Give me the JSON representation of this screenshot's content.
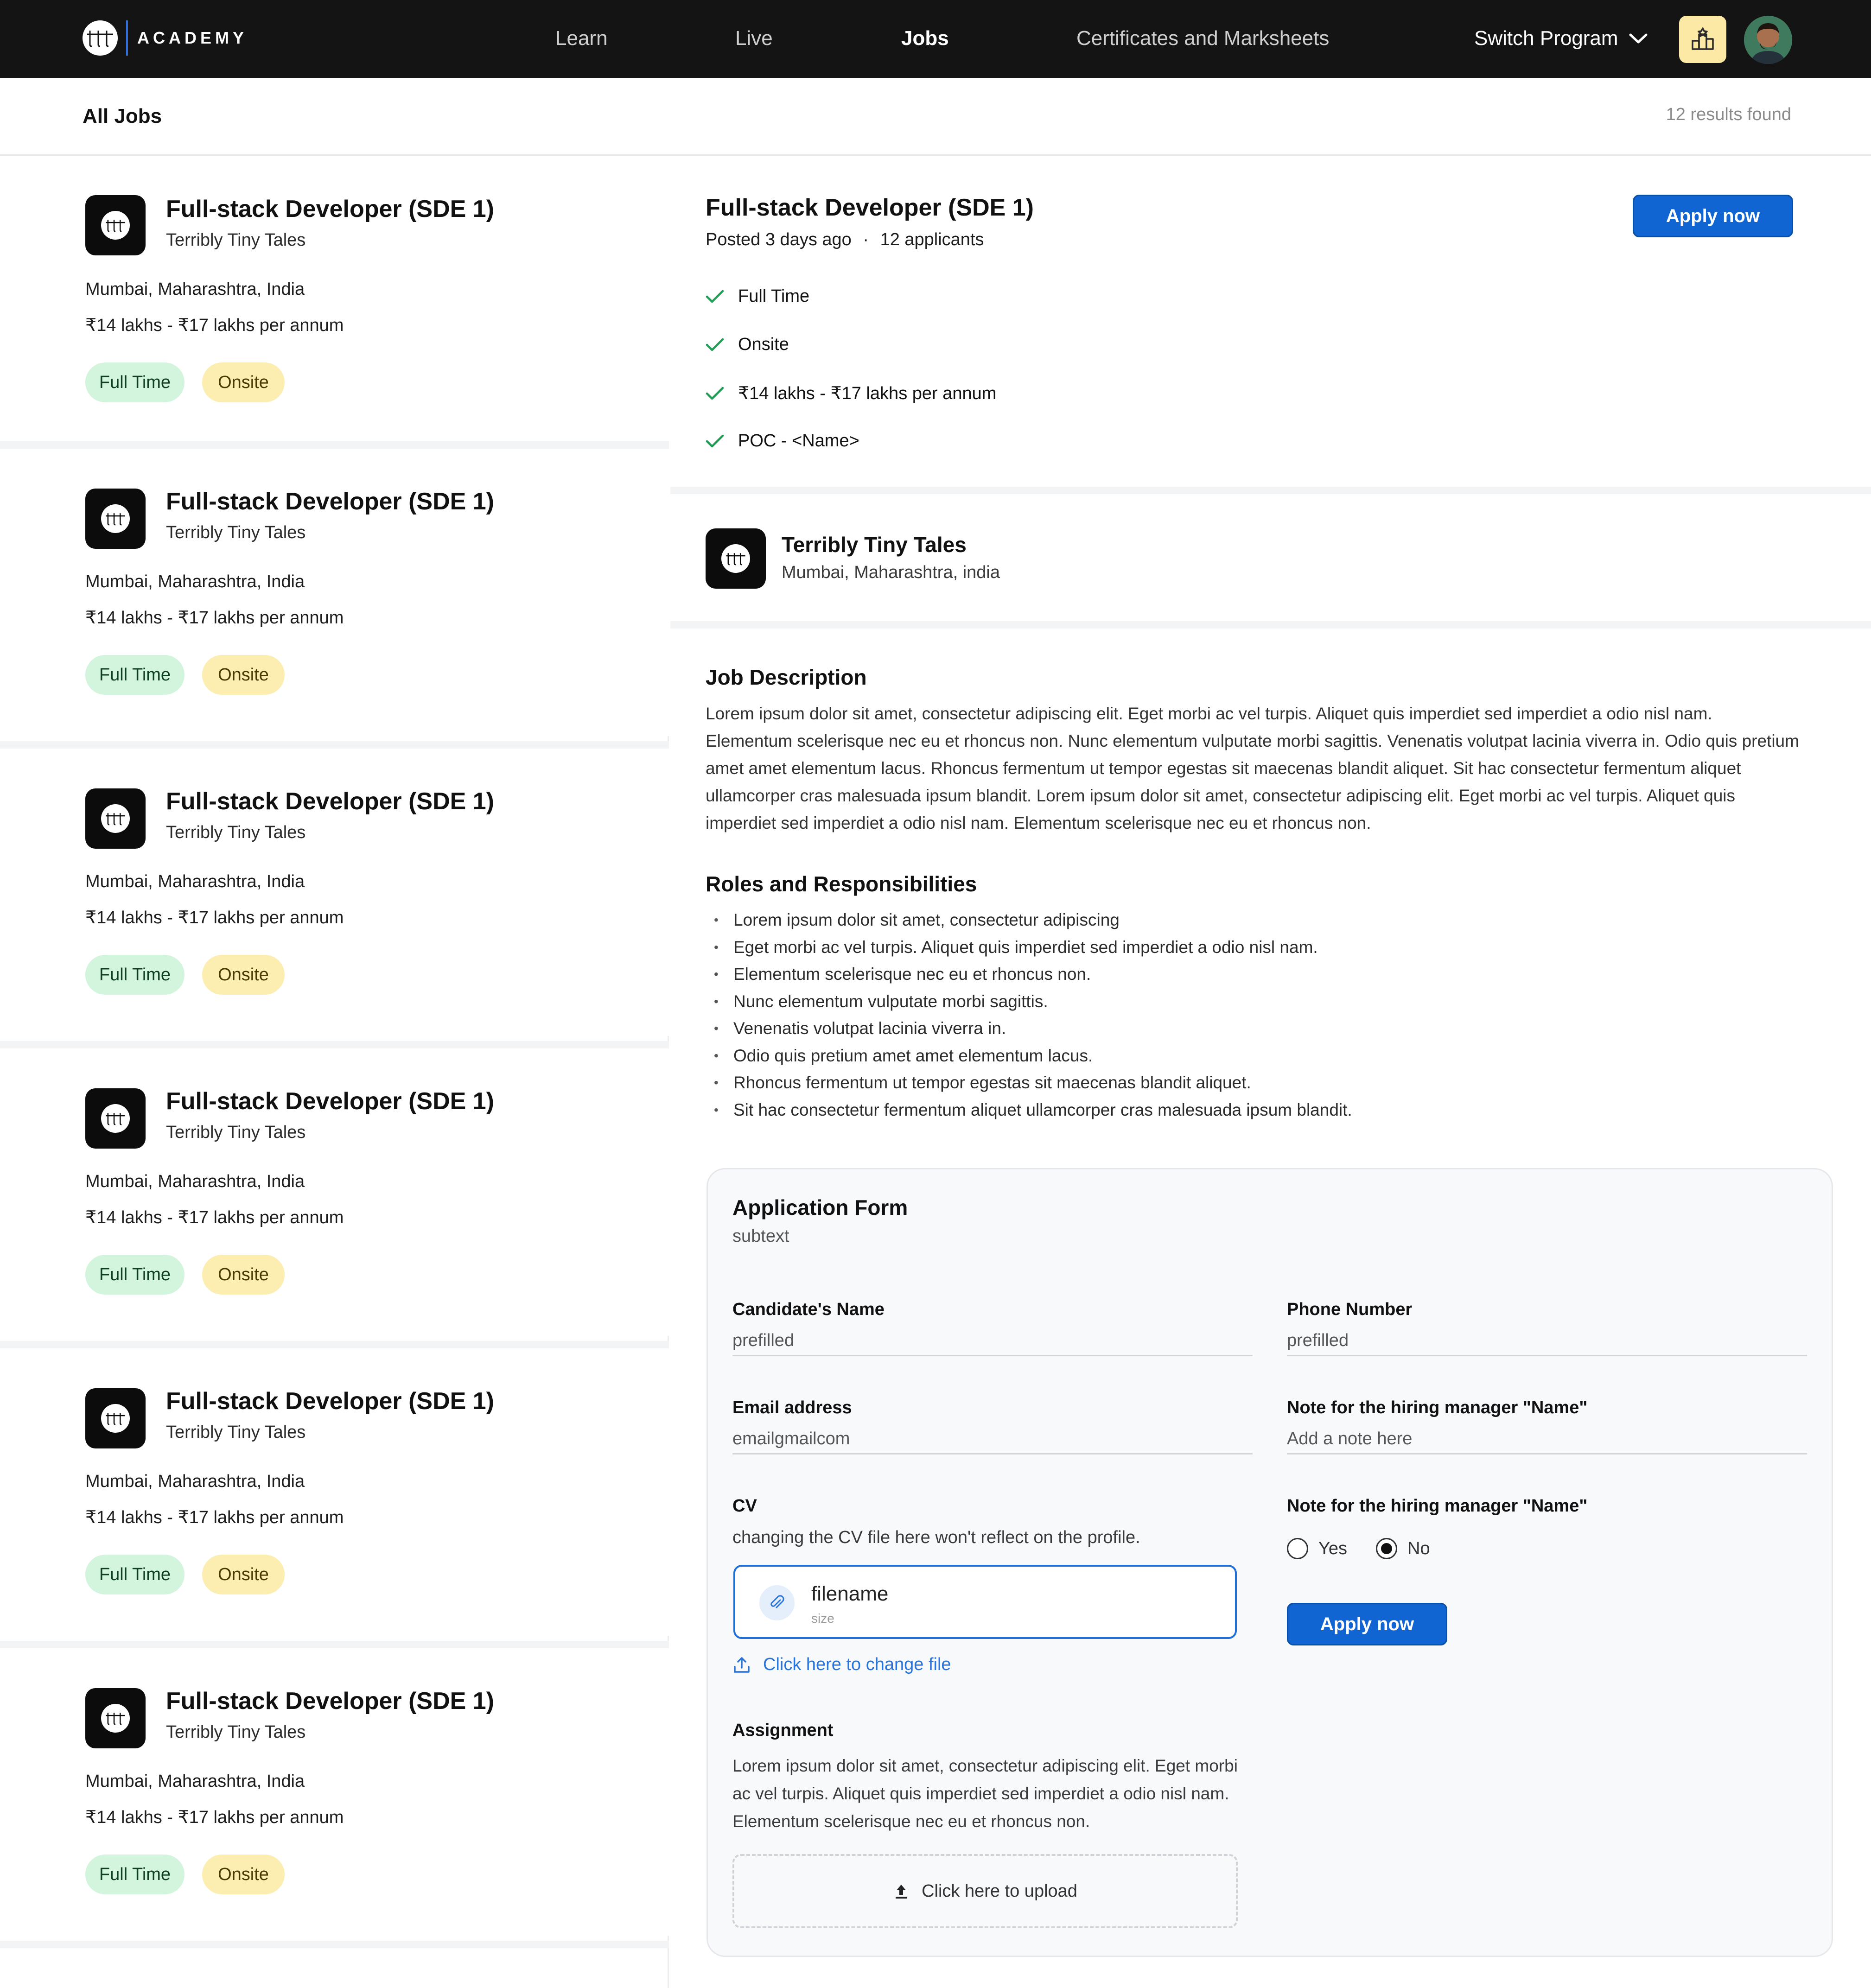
{
  "nav": {
    "brand": "ACADEMY",
    "links": [
      "Learn",
      "Live",
      "Jobs",
      "Certificates and Marksheets"
    ],
    "active": "Jobs",
    "switch_program": "Switch Program",
    "icons": {
      "leaderboard": "leaderboard-icon",
      "chevron": "chevron-down-icon",
      "avatar": "user-avatar"
    },
    "colors": {
      "bar": "#141414",
      "leader_button": "#fde9a6"
    }
  },
  "subheader": {
    "title": "All Jobs",
    "results": "12 results found"
  },
  "jobs": [
    {
      "title": "Full-stack Developer (SDE 1)",
      "company": "Terribly Tiny Tales",
      "location": "Mumbai, Maharashtra, India",
      "salary": "₹14 lakhs - ₹17 lakhs per annum",
      "tags": [
        "Full Time",
        "Onsite"
      ]
    },
    {
      "title": "Full-stack Developer (SDE 1)",
      "company": "Terribly Tiny Tales",
      "location": "Mumbai, Maharashtra, India",
      "salary": "₹14 lakhs - ₹17 lakhs per annum",
      "tags": [
        "Full Time",
        "Onsite"
      ]
    },
    {
      "title": "Full-stack Developer (SDE 1)",
      "company": "Terribly Tiny Tales",
      "location": "Mumbai, Maharashtra, India",
      "salary": "₹14 lakhs - ₹17 lakhs per annum",
      "tags": [
        "Full Time",
        "Onsite"
      ]
    },
    {
      "title": "Full-stack Developer (SDE 1)",
      "company": "Terribly Tiny Tales",
      "location": "Mumbai, Maharashtra, India",
      "salary": "₹14 lakhs - ₹17 lakhs per annum",
      "tags": [
        "Full Time",
        "Onsite"
      ]
    },
    {
      "title": "Full-stack Developer (SDE 1)",
      "company": "Terribly Tiny Tales",
      "location": "Mumbai, Maharashtra, India",
      "salary": "₹14 lakhs - ₹17 lakhs per annum",
      "tags": [
        "Full Time",
        "Onsite"
      ]
    },
    {
      "title": "Full-stack Developer (SDE 1)",
      "company": "Terribly Tiny Tales",
      "location": "Mumbai, Maharashtra, India",
      "salary": "₹14 lakhs - ₹17 lakhs per annum",
      "tags": [
        "Full Time",
        "Onsite"
      ]
    }
  ],
  "detail": {
    "title": "Full-stack Developer (SDE 1)",
    "posted": "Posted 3 days ago",
    "applicants": "12 applicants",
    "meta_separator": "·",
    "apply_label": "Apply now",
    "highlights": [
      "Full Time",
      "Onsite",
      "₹14 lakhs - ₹17 lakhs per annum",
      "POC - <Name>"
    ],
    "company": {
      "name": "Terribly Tiny Tales",
      "location": "Mumbai, Maharashtra, india"
    },
    "description_heading": "Job Description",
    "description": "Lorem ipsum dolor sit amet, consectetur adipiscing elit. Eget morbi ac vel turpis. Aliquet quis imperdiet sed imperdiet a odio nisl nam. Elementum scelerisque nec eu et rhoncus non. Nunc elementum vulputate morbi sagittis. Venenatis volutpat lacinia viverra in. Odio quis pretium amet amet elementum lacus. Rhoncus fermentum ut tempor egestas sit maecenas blandit aliquet. Sit hac consectetur fermentum aliquet ullamcorper cras malesuada ipsum blandit. Lorem ipsum dolor sit amet, consectetur adipiscing elit. Eget morbi ac vel turpis. Aliquet quis imperdiet sed imperdiet a odio nisl nam. Elementum scelerisque nec eu et rhoncus non.",
    "roles_heading": "Roles and Responsibilities",
    "roles": [
      "Lorem ipsum dolor sit amet, consectetur adipiscing",
      "Eget morbi ac vel turpis. Aliquet quis imperdiet sed imperdiet a odio nisl nam.",
      "Elementum scelerisque nec eu et rhoncus non.",
      "Nunc elementum vulputate morbi sagittis.",
      "Venenatis volutpat lacinia viverra in.",
      "Odio quis pretium amet amet elementum lacus.",
      "Rhoncus fermentum ut tempor egestas sit maecenas blandit aliquet.",
      "Sit hac consectetur fermentum aliquet ullamcorper cras malesuada ipsum blandit."
    ]
  },
  "form": {
    "title": "Application Form",
    "subtitle": "subtext",
    "name_label": "Candidate's Name",
    "name_value": "prefilled",
    "phone_label": "Phone Number",
    "phone_value": "prefilled",
    "email_label": "Email address",
    "email_value": "emailgmailcom",
    "note_label": "Note for the hiring manager \"Name\"",
    "note_placeholder": "Add a note here",
    "cv_label": "CV",
    "cv_help": "changing the CV file here won't reflect on the profile.",
    "file_name": "filename",
    "file_size": "size",
    "change_file": "Click here to change file",
    "assignment_label": "Assignment",
    "assignment_text": "Lorem ipsum dolor sit amet, consectetur adipiscing elit. Eget morbi ac vel turpis. Aliquet quis imperdiet sed imperdiet a odio nisl nam. Elementum scelerisque nec eu et rhoncus non.",
    "upload_label": "Click here to upload",
    "radio_label": "Note for the hiring manager \"Name\"",
    "radio_options": [
      "Yes",
      "No"
    ],
    "radio_selected": "No",
    "apply_label": "Apply now",
    "colors": {
      "primary": "#1065d3",
      "link": "#2a74d8",
      "check": "#1f9d55"
    }
  }
}
